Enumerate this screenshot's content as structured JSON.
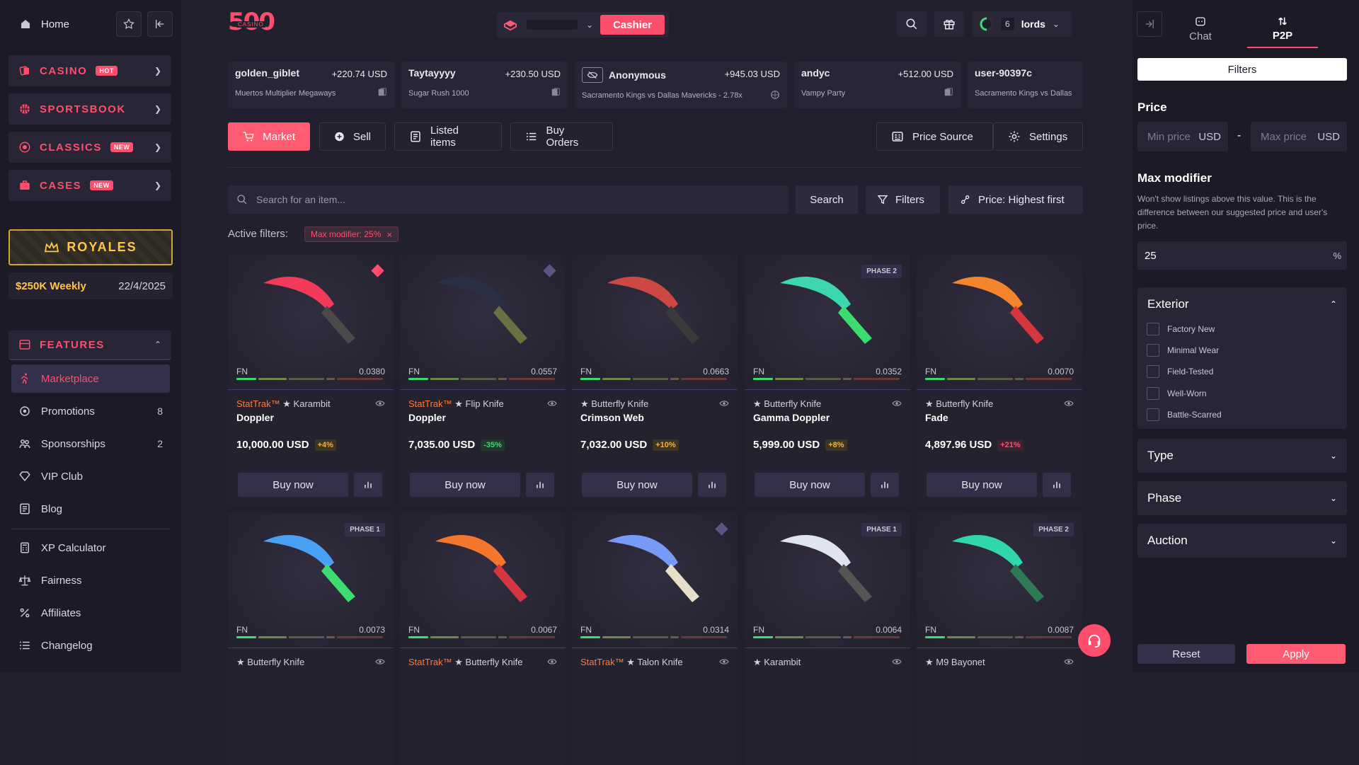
{
  "sidebar": {
    "home_label": "Home",
    "categories": [
      {
        "label": "CASINO",
        "badge": "HOT"
      },
      {
        "label": "SPORTSBOOK",
        "badge": ""
      },
      {
        "label": "CLASSICS",
        "badge": "NEW"
      },
      {
        "label": "CASES",
        "badge": "NEW"
      }
    ],
    "royales": {
      "title": "ROYALES",
      "prize": "$250K Weekly",
      "date": "22/4/2025"
    },
    "features_label": "FEATURES",
    "items": [
      {
        "label": "Marketplace",
        "count": ""
      },
      {
        "label": "Promotions",
        "count": "8"
      },
      {
        "label": "Sponsorships",
        "count": "2"
      },
      {
        "label": "VIP Club",
        "count": ""
      },
      {
        "label": "Blog",
        "count": ""
      },
      {
        "label": "XP Calculator",
        "count": ""
      },
      {
        "label": "Fairness",
        "count": ""
      },
      {
        "label": "Affiliates",
        "count": ""
      },
      {
        "label": "Changelog",
        "count": ""
      }
    ]
  },
  "header": {
    "logo_top": "500",
    "logo_sub": "CASINO",
    "cashier_label": "Cashier",
    "user_count": "6",
    "username": "lords"
  },
  "recent_wins": [
    {
      "user": "golden_giblet",
      "amount": "+220.74",
      "currency": "USD",
      "game": "Muertos Multiplier Megaways"
    },
    {
      "user": "Taytayyyy",
      "amount": "+230.50",
      "currency": "USD",
      "game": "Sugar Rush 1000"
    },
    {
      "user": "Anonymous",
      "amount": "+945.03",
      "currency": "USD",
      "game": "Sacramento Kings vs Dallas Mavericks - 2.78x"
    },
    {
      "user": "andyc",
      "amount": "+512.00",
      "currency": "USD",
      "game": "Vampy Party"
    },
    {
      "user": "user-90397c",
      "amount": "",
      "currency": "",
      "game": "Sacramento Kings vs Dallas"
    }
  ],
  "tabs": {
    "market": "Market",
    "sell": "Sell",
    "listed": "Listed items",
    "buy_orders": "Buy Orders",
    "price_source": "Price Source",
    "settings": "Settings"
  },
  "search": {
    "placeholder": "Search for an item...",
    "search_label": "Search",
    "filters_label": "Filters",
    "sort_label": "Price: Highest first"
  },
  "active_filters": {
    "label": "Active filters:",
    "chip": "Max modifier: 25%",
    "chip_close": "×"
  },
  "items": [
    {
      "stattrak": "StatTrak™",
      "type": "★ Karambit",
      "skin": "Doppler",
      "price": "10,000.00 USD",
      "pct": "+4%",
      "pct_kind": "up",
      "exterior": "FN",
      "float": "0.0380",
      "phase": "",
      "gem": "#ff4d6d"
    },
    {
      "stattrak": "StatTrak™",
      "type": "★ Flip Knife",
      "skin": "Doppler",
      "price": "7,035.00 USD",
      "pct": "-35%",
      "pct_kind": "dn",
      "exterior": "FN",
      "float": "0.0557",
      "phase": "",
      "gem": "#5b5680"
    },
    {
      "stattrak": "",
      "type": "★ Butterfly Knife",
      "skin": "Crimson Web",
      "price": "7,032.00 USD",
      "pct": "+10%",
      "pct_kind": "up",
      "exterior": "FN",
      "float": "0.0663",
      "phase": "",
      "gem": ""
    },
    {
      "stattrak": "",
      "type": "★ Butterfly Knife",
      "skin": "Gamma Doppler",
      "price": "5,999.00 USD",
      "pct": "+8%",
      "pct_kind": "up",
      "exterior": "FN",
      "float": "0.0352",
      "phase": "PHASE 2",
      "gem": ""
    },
    {
      "stattrak": "",
      "type": "★ Butterfly Knife",
      "skin": "Fade",
      "price": "4,897.96 USD",
      "pct": "+21%",
      "pct_kind": "bad",
      "exterior": "FN",
      "float": "0.0070",
      "phase": "",
      "gem": ""
    },
    {
      "stattrak": "",
      "type": "★ Butterfly Knife",
      "skin": "",
      "price": "",
      "pct": "",
      "pct_kind": "",
      "exterior": "FN",
      "float": "0.0073",
      "phase": "PHASE 1",
      "gem": ""
    },
    {
      "stattrak": "StatTrak™",
      "type": "★ Butterfly Knife",
      "skin": "",
      "price": "",
      "pct": "",
      "pct_kind": "",
      "exterior": "FN",
      "float": "0.0067",
      "phase": "",
      "gem": ""
    },
    {
      "stattrak": "StatTrak™",
      "type": "★ Talon Knife",
      "skin": "",
      "price": "",
      "pct": "",
      "pct_kind": "",
      "exterior": "FN",
      "float": "0.0314",
      "phase": "",
      "gem": "#5b5680"
    },
    {
      "stattrak": "",
      "type": "★ Karambit",
      "skin": "",
      "price": "",
      "pct": "",
      "pct_kind": "",
      "exterior": "FN",
      "float": "0.0064",
      "phase": "PHASE 1",
      "gem": ""
    },
    {
      "stattrak": "",
      "type": "★ M9 Bayonet",
      "skin": "",
      "price": "",
      "pct": "",
      "pct_kind": "",
      "exterior": "FN",
      "float": "0.0087",
      "phase": "PHASE 2",
      "gem": ""
    }
  ],
  "buy_label": "Buy now",
  "right_panel": {
    "tab_chat": "Chat",
    "tab_p2p": "P2P",
    "filters_btn": "Filters",
    "price_title": "Price",
    "min_placeholder": "Min price",
    "max_placeholder": "Max price",
    "currency": "USD",
    "dash": "-",
    "max_mod_title": "Max modifier",
    "max_mod_desc": "Won't show listings above this value. This is the difference between our suggested price and user's price.",
    "max_mod_value": "25",
    "percent": "%",
    "exterior_title": "Exterior",
    "exterior_options": [
      "Factory New",
      "Minimal Wear",
      "Field-Tested",
      "Well-Worn",
      "Battle-Scarred"
    ],
    "type_title": "Type",
    "phase_title": "Phase",
    "auction_title": "Auction",
    "reset": "Reset",
    "apply": "Apply"
  },
  "colors": {
    "accent": "#ff4d6d",
    "gold": "#ffc64a",
    "bg": "#22202e"
  }
}
